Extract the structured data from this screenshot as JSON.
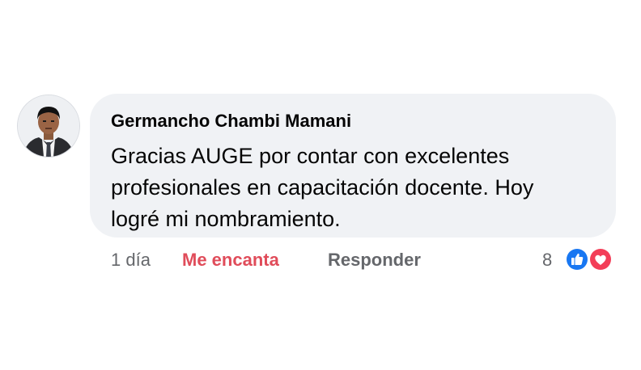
{
  "comment": {
    "author": "Germancho Chambi Mamani",
    "text_lines": [
      "Gracias AUGE por contar con excelentes",
      "profesionales en capacitación docente. Hoy",
      "logré mi nombramiento."
    ],
    "timestamp": "1 día",
    "reaction_action": "Me encanta",
    "reply_action": "Responder",
    "reaction_count": "8",
    "reaction_icons": [
      "like-icon",
      "heart-icon"
    ]
  },
  "colors": {
    "bubble_bg": "#f0f2f5",
    "love_text": "#e04c5a",
    "secondary_text": "#65676b",
    "like_blue": "#1877f2",
    "heart_red": "#f33e58"
  }
}
